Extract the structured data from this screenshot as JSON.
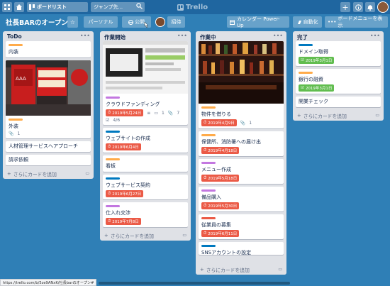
{
  "topbar": {
    "boards_label": "ボードリスト",
    "search_placeholder": "ジャンプ先...",
    "logo": "Trello",
    "buttons": [
      "+",
      "i",
      "bell"
    ]
  },
  "board": {
    "title": "社長BARのオープン",
    "star": "☆",
    "visibility": "パーソナル",
    "public_label": "公開",
    "invite_label": "招待",
    "calendar_label": "カレンダー Power-Up",
    "automation_label": "自動化",
    "menu_label": "ボードメニューを表示"
  },
  "colors": {
    "green": "#61bd4f",
    "red": "#eb5a46",
    "orange": "#ffab4a",
    "blue": "#0079bf",
    "purple": "#c377e0",
    "yellow": "#f2d600"
  },
  "lists": [
    {
      "title": "ToDo",
      "add": "さらにカードを追加",
      "cards": [
        {
          "label": "orange",
          "text": "内装"
        },
        {
          "cover": "photo-storefront",
          "label": "orange",
          "text": "外装",
          "attachments": "1"
        },
        {
          "text": "人材管理サービスへアプローチ"
        },
        {
          "text": "請求依頼"
        }
      ]
    },
    {
      "title": "作業開始",
      "add": "さらにカードを追加",
      "cards": [
        {
          "cover": "screenshot-crowdfunding",
          "label": "purple",
          "text": "クラウドファンディング",
          "due": "2019年5月24日",
          "due_color": "red",
          "comments": "1",
          "attachments": "7",
          "checklist": "4/6"
        },
        {
          "label": "blue",
          "text": "ウェブサイトの作成",
          "due": "2019年6月4日",
          "due_color": "red"
        },
        {
          "label": "orange",
          "text": "看板"
        },
        {
          "label": "blue",
          "text": "ウェブサービス契約",
          "due": "2019年6月27日",
          "due_color": "red"
        },
        {
          "label": "purple",
          "text": "仕入れ交渉",
          "due": "2019年7月8日",
          "due_color": "red"
        }
      ]
    },
    {
      "title": "作業中",
      "add": "さらにカードを追加",
      "cards": [
        {
          "cover": "photo-bar-shelves",
          "label": "orange",
          "text": "物件を借りる",
          "due": "2019年4月9日",
          "due_color": "red",
          "attachments": "1"
        },
        {
          "label": "orange",
          "text": "保健所、消防署への届け出",
          "due": "2019年4月18日",
          "due_color": "red"
        },
        {
          "label": "purple",
          "text": "メニュー作成",
          "due": "2019年5月18日",
          "due_color": "red"
        },
        {
          "label": "purple",
          "text": "備品購入",
          "due": "2019年5月30日",
          "due_color": "red"
        },
        {
          "label": "red",
          "text": "従業員の募集",
          "due": "2019年6月11日",
          "due_color": "red"
        },
        {
          "label": "blue",
          "text": "SNSアカウントの設定"
        }
      ]
    },
    {
      "title": "完了",
      "add": "さらにカードを追加",
      "cards": [
        {
          "label": "blue",
          "text": "ドメイン取得",
          "due": "2019年3月1日",
          "due_color": "green"
        },
        {
          "label": "orange",
          "text": "銀行の融資",
          "due": "2019年3月1日",
          "due_color": "green"
        },
        {
          "text": "開業チェック"
        }
      ]
    }
  ],
  "status_url": "https://trello.com/b/5ze9ANxK/社長barのオープン#"
}
